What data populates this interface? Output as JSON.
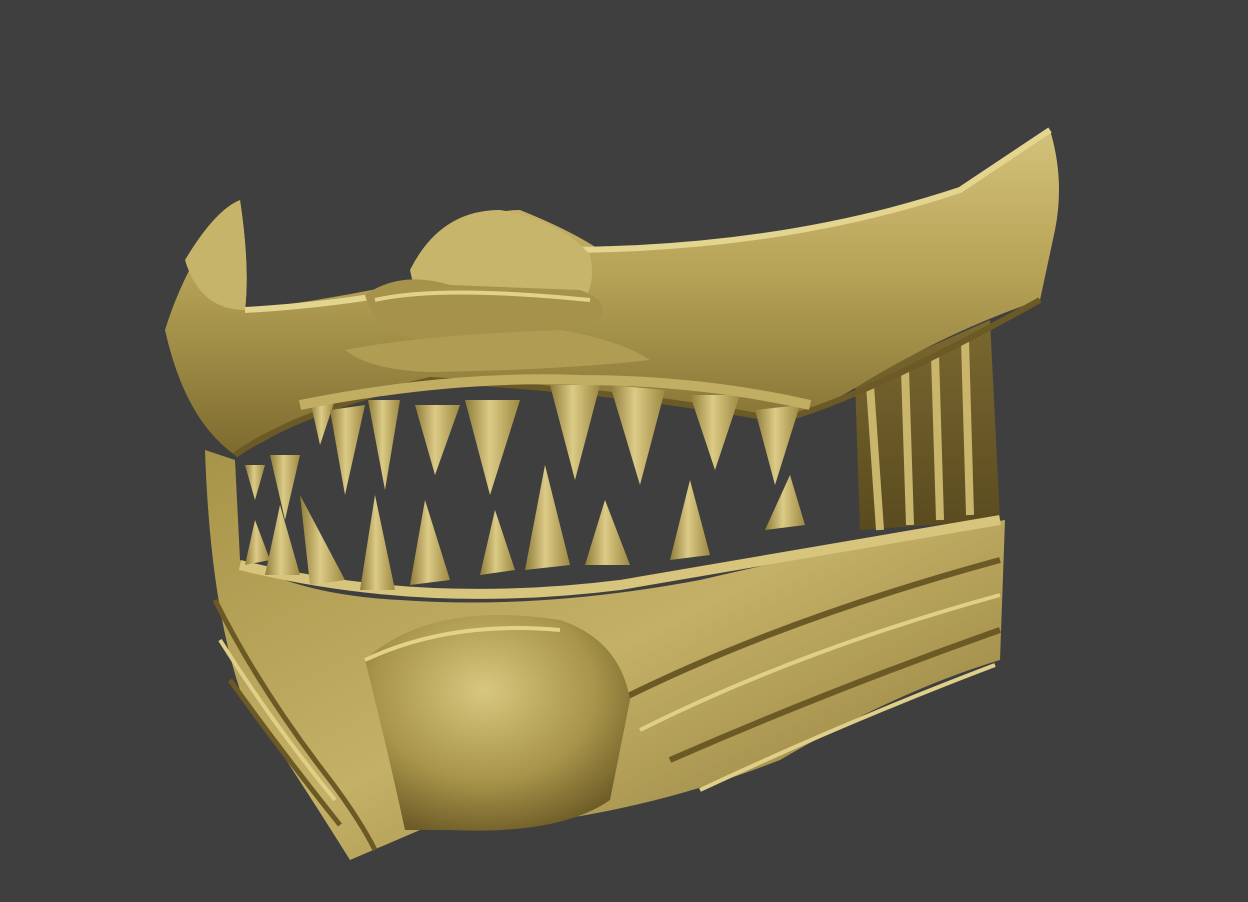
{
  "scene": {
    "background_color": "#3f3f3f",
    "subject": "mask-model",
    "material_colors": {
      "base": "#b5a157",
      "light": "#d6c47c",
      "mid": "#a89449",
      "shadow": "#6b5a26",
      "deep": "#4a3d18"
    }
  }
}
